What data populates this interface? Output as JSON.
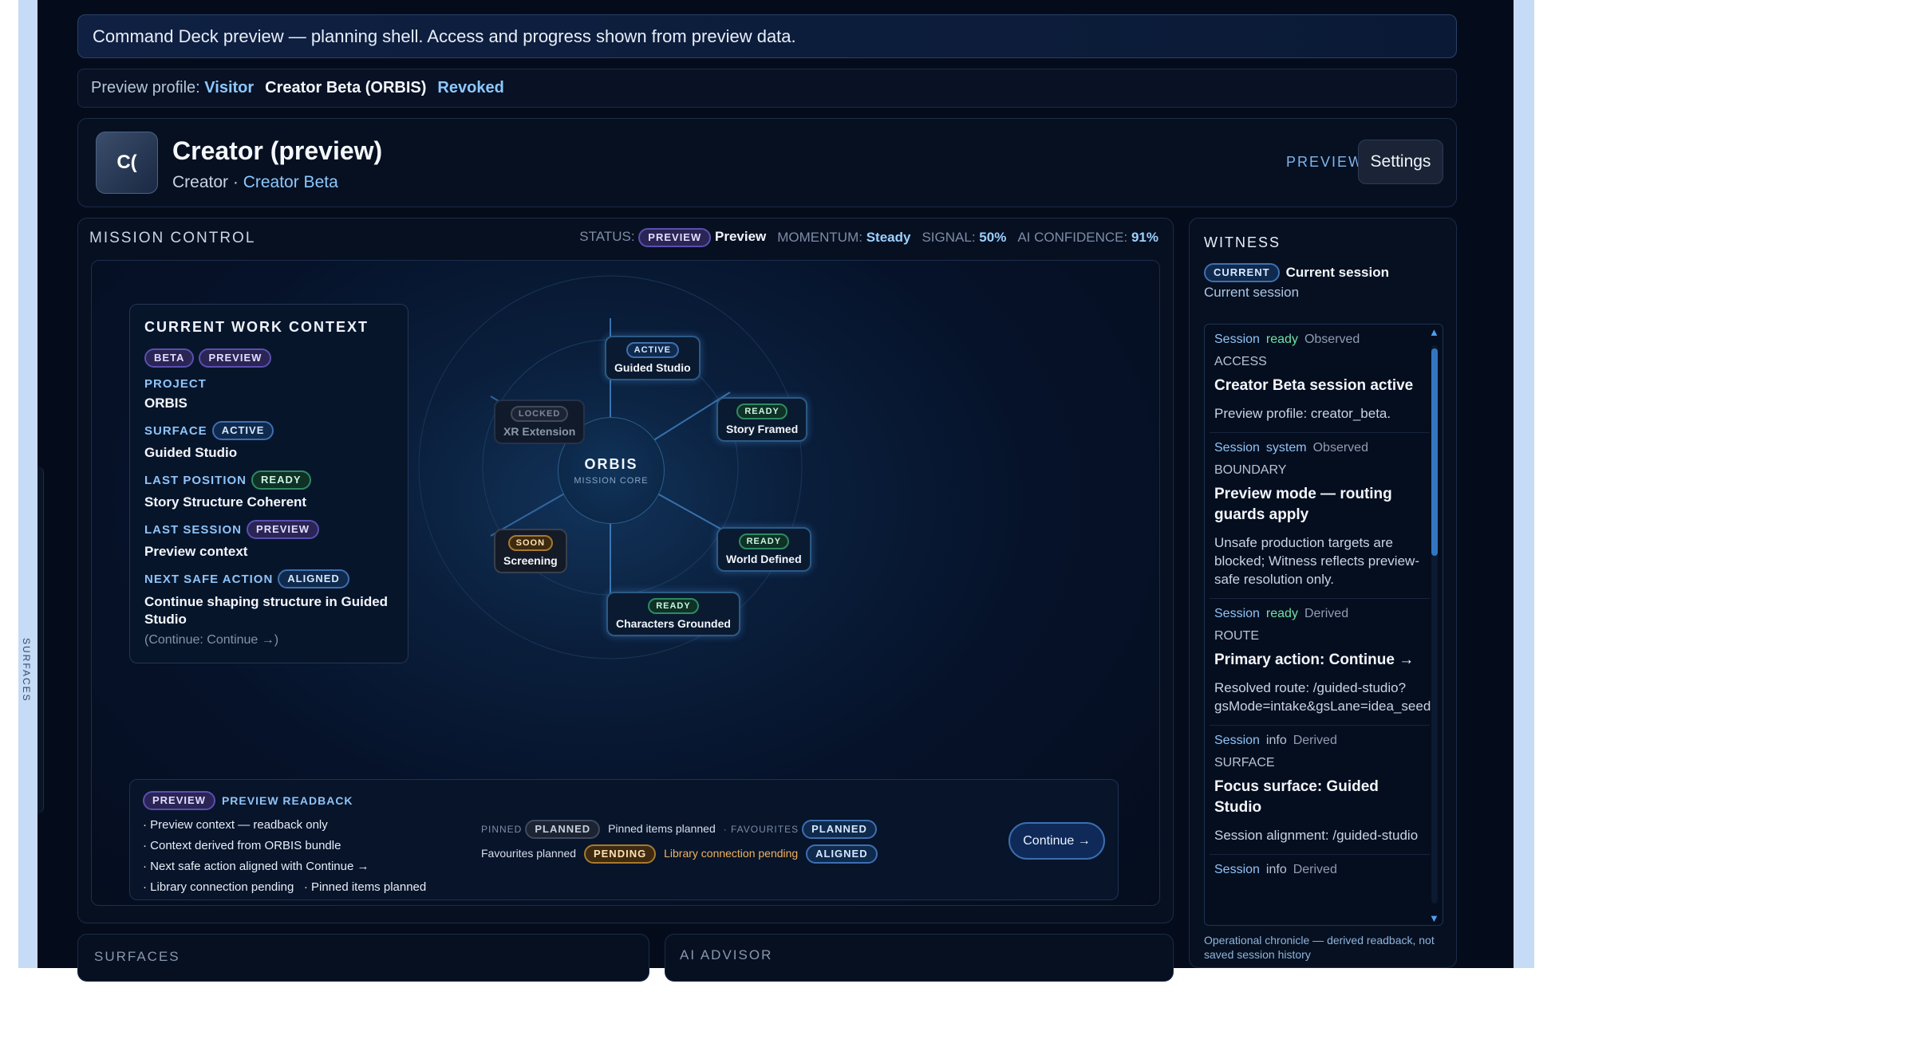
{
  "banner": {
    "text": "Command Deck preview — planning shell. Access and progress shown from preview data."
  },
  "profile": {
    "label": "Preview profile:",
    "visitor": "Visitor",
    "creator": "Creator Beta (ORBIS)",
    "revoked": "Revoked"
  },
  "header": {
    "avatar": "C(",
    "title": "Creator (preview)",
    "role": "Creator ·",
    "role_link": "Creator Beta",
    "preview": "PREVIEW",
    "settings": "Settings"
  },
  "mission": {
    "title": "MISSION CONTROL",
    "status_label": "STATUS:",
    "status_pill": "PREVIEW",
    "status_value": "Preview",
    "momentum_label": "MOMENTUM:",
    "momentum_value": "Steady",
    "signal_label": "SIGNAL:",
    "signal_value": "50%",
    "ai_label": "AI CONFIDENCE:",
    "ai_value": "91%"
  },
  "context": {
    "title": "CURRENT WORK CONTEXT",
    "pill_beta": "BETA",
    "pill_preview": "PREVIEW",
    "project_label": "PROJECT",
    "project_value": "ORBIS",
    "surface_label": "SURFACE",
    "surface_pill": "ACTIVE",
    "surface_value": "Guided Studio",
    "lastpos_label": "LAST POSITION",
    "lastpos_pill": "READY",
    "lastpos_value": "Story Structure Coherent",
    "lastsession_label": "LAST SESSION",
    "lastsession_pill": "PREVIEW",
    "lastsession_value": "Preview context",
    "next_label": "NEXT SAFE ACTION",
    "next_pill": "ALIGNED",
    "next_value": "Continue shaping structure in Guided Studio",
    "next_note": "(Continue: Continue →)"
  },
  "orbit": {
    "core_title": "ORBIS",
    "core_sub": "MISSION CORE",
    "nodes": [
      {
        "pill": "ACTIVE",
        "label": "Guided Studio"
      },
      {
        "pill": "READY",
        "label": "Story Framed"
      },
      {
        "pill": "READY",
        "label": "World Defined"
      },
      {
        "pill": "READY",
        "label": "Characters Grounded"
      },
      {
        "pill": "SOON",
        "label": "Screening"
      },
      {
        "pill": "LOCKED",
        "label": "XR Extension"
      }
    ]
  },
  "readback": {
    "pill": "PREVIEW",
    "title": "PREVIEW READBACK",
    "lines": [
      "· Preview context — readback only",
      "· Context derived from ORBIS bundle",
      "· Next safe action aligned with Continue →"
    ],
    "line4a": "· Library connection pending",
    "line4b": "· Pinned items planned",
    "pinned_label": "PINNED",
    "pinned_pill": "PLANNED",
    "pinned_text": "Pinned items planned",
    "fav_label": "· FAVOURITES",
    "fav_pill": "PLANNED",
    "fav_text": "Favourites planned",
    "lib_pill": "PENDING",
    "lib_text": "Library connection pending",
    "aligned_pill": "ALIGNED",
    "continue": "Continue →"
  },
  "surfaces": {
    "title": "SURFACES"
  },
  "advisor": {
    "title": "AI ADVISOR"
  },
  "sidebar_edge": {
    "label": "SURFACES"
  },
  "witness": {
    "title": "WITNESS",
    "current_pill": "CURRENT",
    "current_title": "Current session",
    "current_sub": "Current session",
    "entries": [
      {
        "src": "Session",
        "status": "ready",
        "kind": "Observed",
        "cat": "ACCESS",
        "head": "Creator Beta session active",
        "body": "Preview profile: creator_beta."
      },
      {
        "src": "Session",
        "status": "system",
        "kind": "Observed",
        "cat": "BOUNDARY",
        "head": "Preview mode — routing guards apply",
        "body": "Unsafe production targets are blocked; Witness reflects preview-safe resolution only."
      },
      {
        "src": "Session",
        "status": "ready",
        "kind": "Derived",
        "cat": "ROUTE",
        "head": "Primary action: Continue →",
        "body": "Resolved route: /guided-studio?gsMode=intake&gsLane=idea_seed"
      },
      {
        "src": "Session",
        "status": "info",
        "kind": "Derived",
        "cat": "SURFACE",
        "head": "Focus surface: Guided Studio",
        "body": "Session alignment: /guided-studio"
      },
      {
        "src": "Session",
        "status": "info",
        "kind": "Derived",
        "cat": "",
        "head": "",
        "body": ""
      }
    ],
    "footer": "Operational chronicle — derived readback, not saved session history"
  }
}
